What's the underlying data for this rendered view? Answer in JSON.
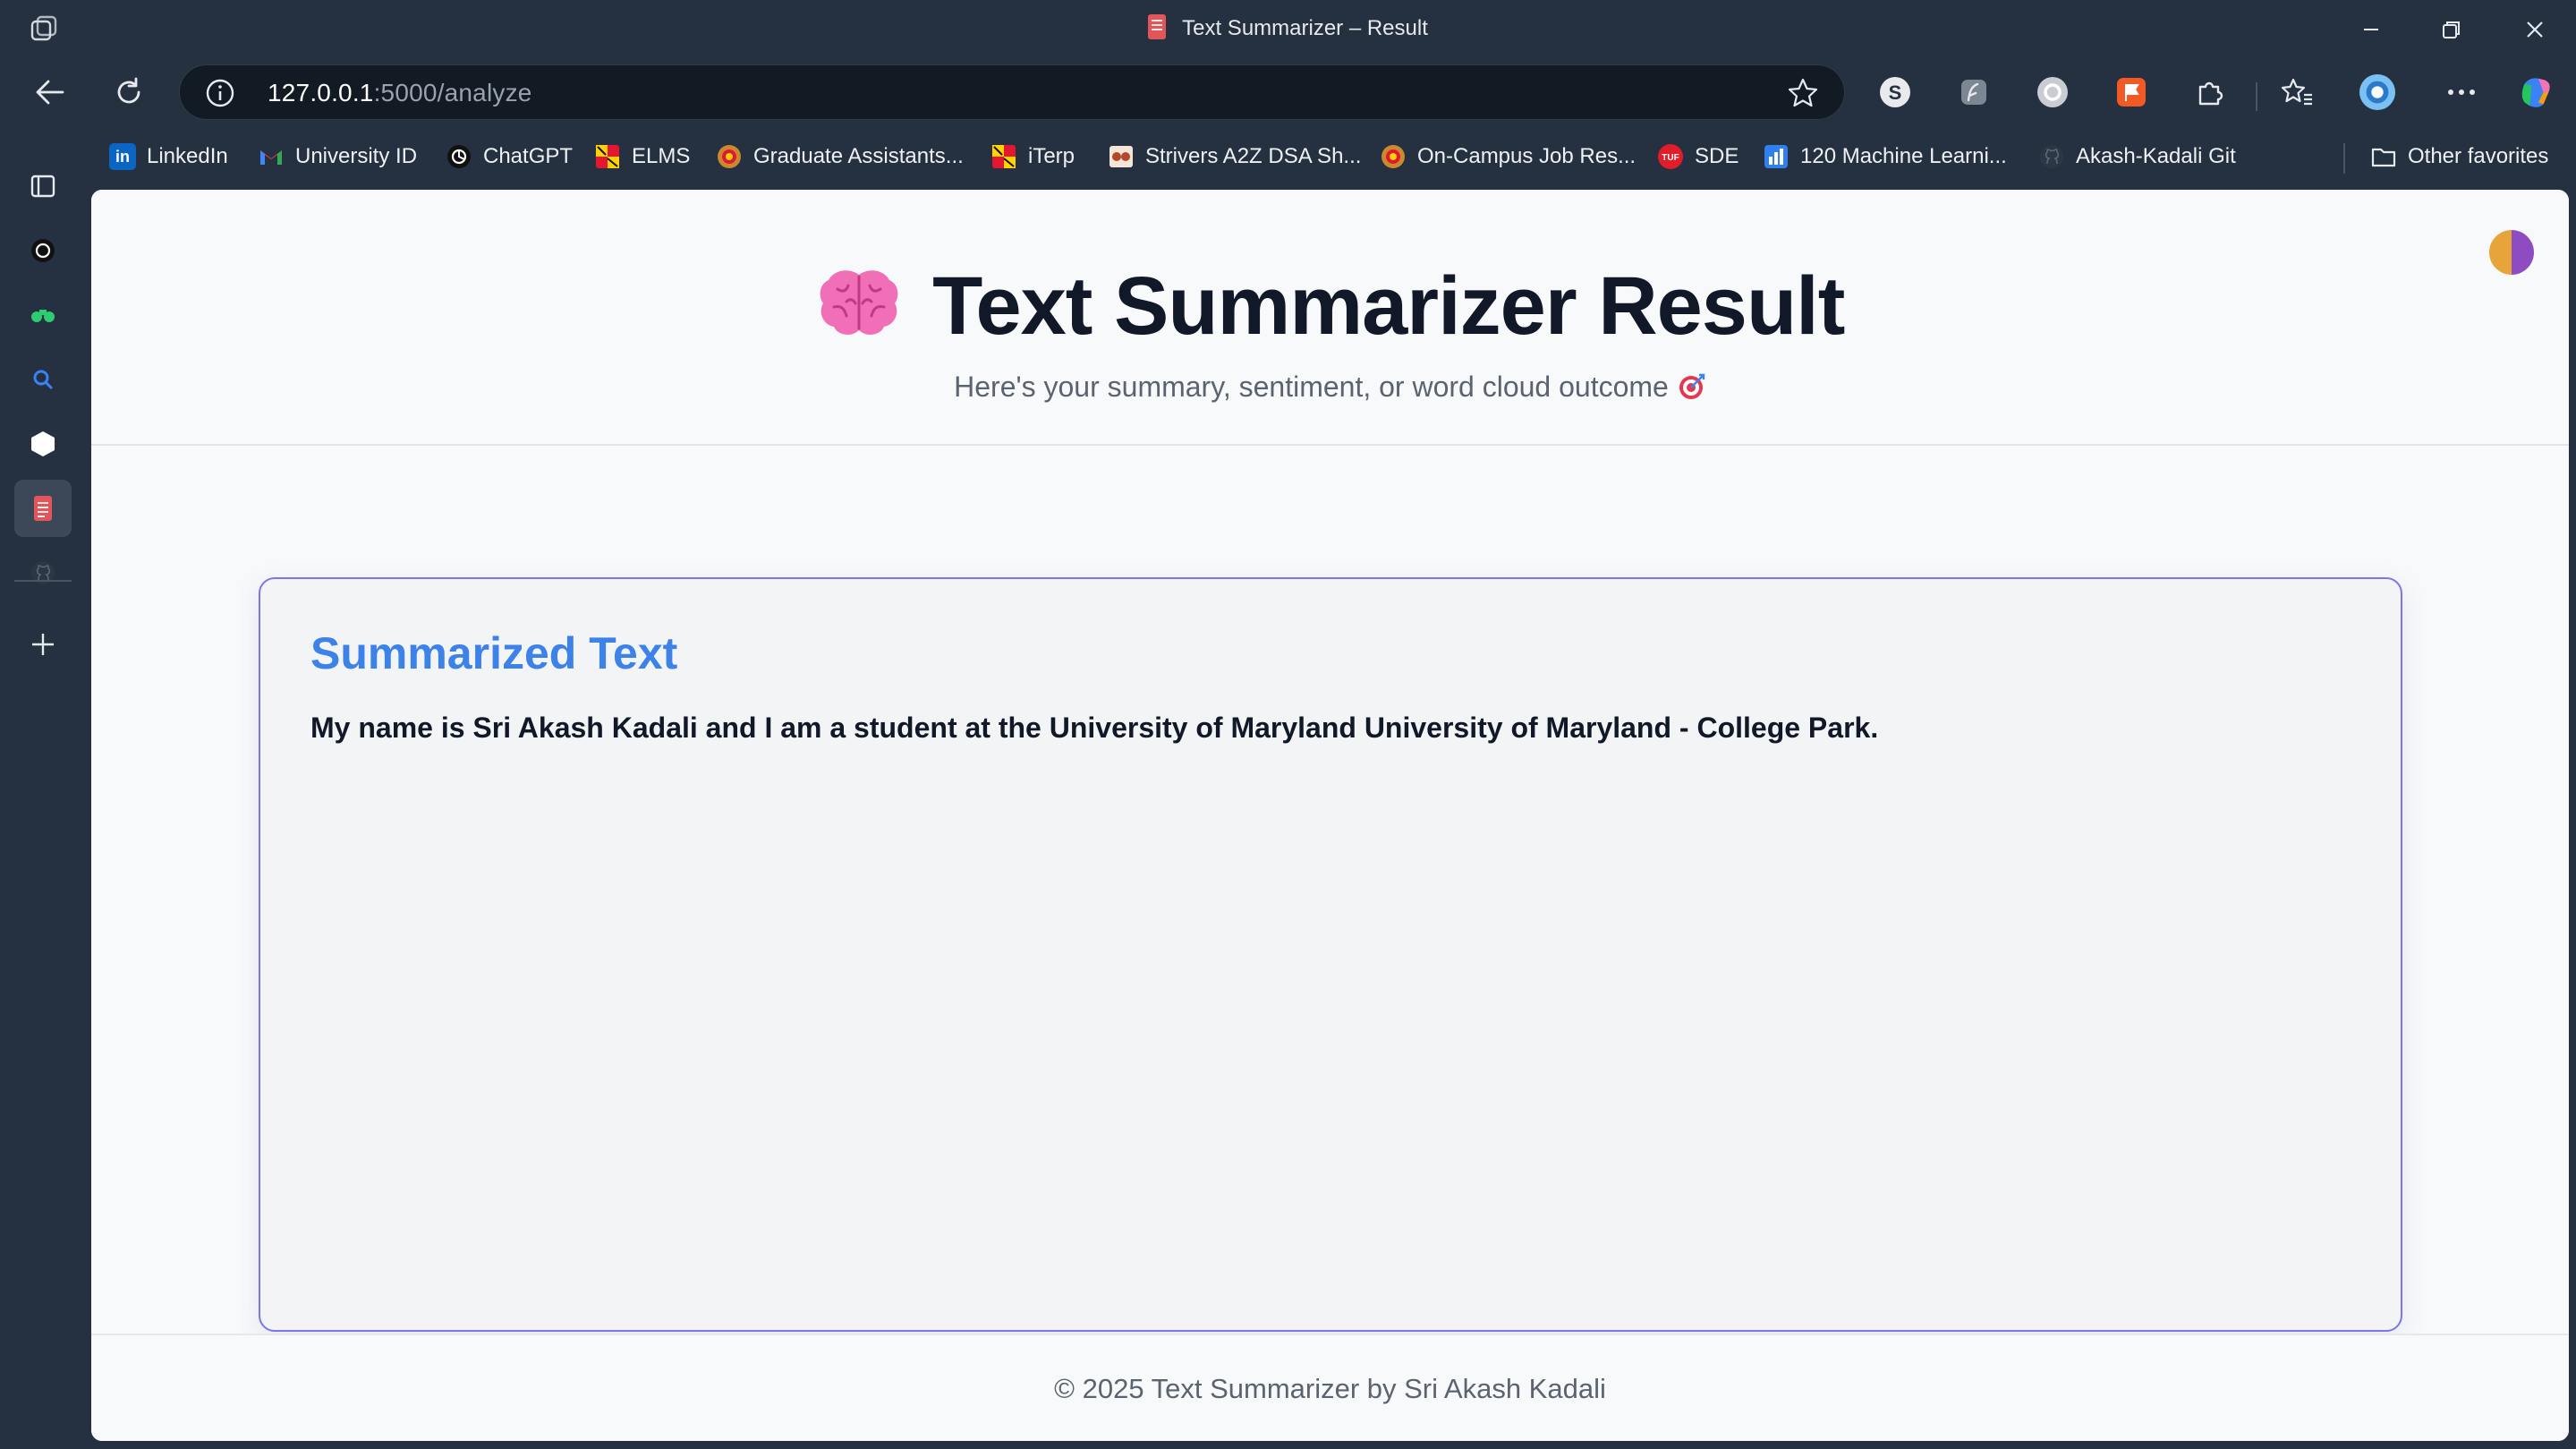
{
  "browser": {
    "tab_title": "Text Summarizer – Result",
    "url_host": "127.0.0.1",
    "url_rest": ":5000/analyze"
  },
  "bookmarks": [
    {
      "label": "LinkedIn",
      "icon": "linkedin-icon"
    },
    {
      "label": "University ID",
      "icon": "gmail-icon"
    },
    {
      "label": "ChatGPT",
      "icon": "chatgpt-icon"
    },
    {
      "label": "ELMS",
      "icon": "umd-icon"
    },
    {
      "label": "Graduate Assistants...",
      "icon": "umd-seal-icon"
    },
    {
      "label": "iTerp",
      "icon": "umd-icon"
    },
    {
      "label": "Strivers A2Z DSA Sh...",
      "icon": "tuf-icon"
    },
    {
      "label": "On-Campus Job Res...",
      "icon": "umd-seal-icon"
    },
    {
      "label": "SDE",
      "icon": "tuf-icon"
    },
    {
      "label": "120 Machine Learni...",
      "icon": "chart-icon"
    },
    {
      "label": "Akash-Kadali Git",
      "icon": "github-icon"
    },
    {
      "label": "Other favorites",
      "icon": "folder-icon"
    }
  ],
  "page": {
    "title": "Text Summarizer Result",
    "subtitle": "Here's your summary, sentiment, or word cloud outcome",
    "card_title": "Summarized Text",
    "summary": "My name is Sri Akash Kadali and I am a student at the University of Maryland University of Maryland - College Park.",
    "footer": "© 2025 Text Summarizer by Sri Akash Kadali"
  },
  "colors": {
    "accent": "#3c82e8",
    "card_border": "#7c76ea",
    "browser_chrome": "#253040"
  }
}
